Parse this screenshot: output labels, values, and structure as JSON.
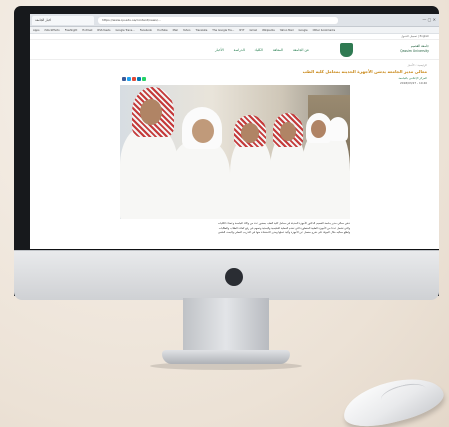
{
  "browser": {
    "tab_label": "اخبار الجامعة",
    "url": "https://www.qu.edu.sa/content/news/…",
    "window_controls": "— ▢ ✕",
    "bookmarks": [
      "Apps",
      "iStockPhoto",
      "Flashlight",
      "Hotmail",
      "RSS feeds",
      "Google Trans…",
      "Facebook",
      "YouTube",
      "Mail",
      "Yahoo",
      "Translate",
      "The Google Tra…",
      "NYT",
      "Gmail",
      "Wikipedia",
      "Yahoo Mail",
      "Google",
      "Other bookmarks"
    ]
  },
  "site": {
    "top_strip": "English  |  تسجيل الدخول",
    "logo_text_line1": "جامعة القصيم",
    "logo_text_line2": "Qassim University",
    "menu": [
      "عن الجامعة",
      "المعاهد",
      "الكليات",
      "الدراسة",
      "الأخبار"
    ]
  },
  "article": {
    "breadcrumb": "الرئيسية  ›  الأخبار",
    "title": "معالي مدير الجامعة يدشن الأجهزة الحديثة بمعامل كلية الطب",
    "author": "المركز الإعلامي بالجامعة",
    "date": "2018/03/27 - 10:40",
    "body": [
      "دشن معالي مدير جامعة القصيم الدكتور الأجهزة الحديثة في معامل كلية الطب بحضور عدد من وكلاء الجامعة وعمداء الكليات",
      "والتي تشمل عددا من الأجهزة الطبية المتطورة التي تخدم العملية التعليمية والبحثية وتسهم في رفع كفاءة الطلاب والطالبات",
      "واطلع معاليه خلال الجولة على شرح مفصل عن الأجهزة وآلية عملها ومدى الاستفادة منها في التدريب العملي والبحث العلمي"
    ]
  },
  "colors": {
    "accent_green": "#1f7a4a",
    "title_gold": "#c9891a",
    "share_icons": [
      "#3b5998",
      "#1da1f2",
      "#dd4b39",
      "#0077b5",
      "#25d366"
    ]
  }
}
